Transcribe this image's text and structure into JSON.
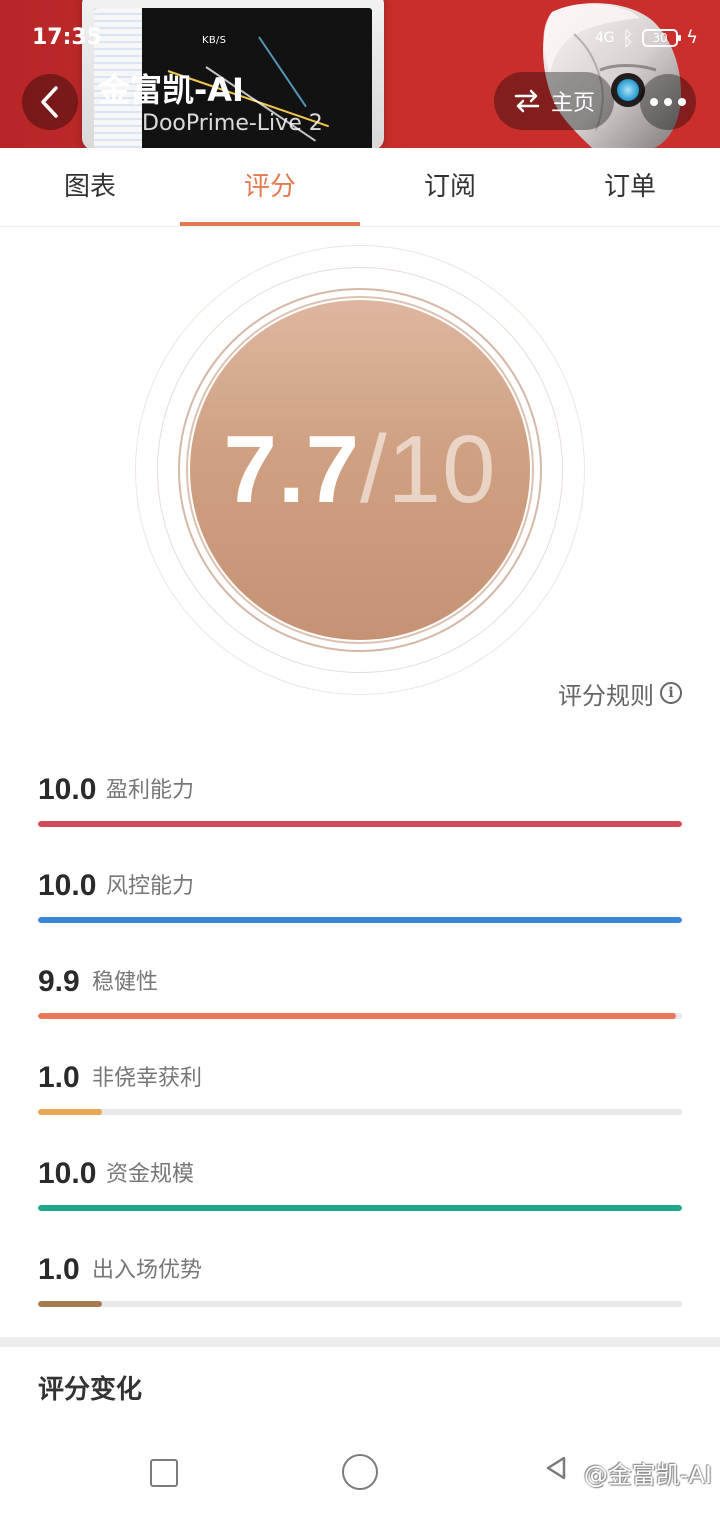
{
  "status_bar": {
    "time": "17:35",
    "network_speed": "KB/S",
    "network_type": "4G",
    "battery_level": "30"
  },
  "header": {
    "back_icon": "chevron-left-icon",
    "title": "金富凯-AI",
    "subtitle": "DooPrime-Live 2",
    "home_label": "主页",
    "home_icon": "swap-icon",
    "more_icon": "more-horizontal-icon"
  },
  "tabs": [
    {
      "label": "图表",
      "active": false
    },
    {
      "label": "评分",
      "active": true
    },
    {
      "label": "订阅",
      "active": false
    },
    {
      "label": "订单",
      "active": false
    }
  ],
  "score": {
    "value": "7.7",
    "max": "/10"
  },
  "rules_link": {
    "label": "评分规则",
    "icon": "info-icon"
  },
  "metrics": [
    {
      "value": "10.0",
      "label": "盈利能力",
      "fraction": 1.0,
      "color": "#d24a55"
    },
    {
      "value": "10.0",
      "label": "风控能力",
      "fraction": 1.0,
      "color": "#3a87d6"
    },
    {
      "value": "9.9",
      "label": "稳健性",
      "fraction": 0.99,
      "color": "#e8795b"
    },
    {
      "value": "1.0",
      "label": "非侥幸获利",
      "fraction": 0.1,
      "color": "#e9a852"
    },
    {
      "value": "10.0",
      "label": "资金规模",
      "fraction": 1.0,
      "color": "#1ea88d"
    },
    {
      "value": "1.0",
      "label": "出入场优势",
      "fraction": 0.1,
      "color": "#a97a4e"
    }
  ],
  "section": {
    "title": "评分变化"
  },
  "watermark": "@金富凯-AI",
  "colors": {
    "accent": "#e47a50",
    "header_red": "#c72d2b",
    "score_disc": "#c99778"
  }
}
